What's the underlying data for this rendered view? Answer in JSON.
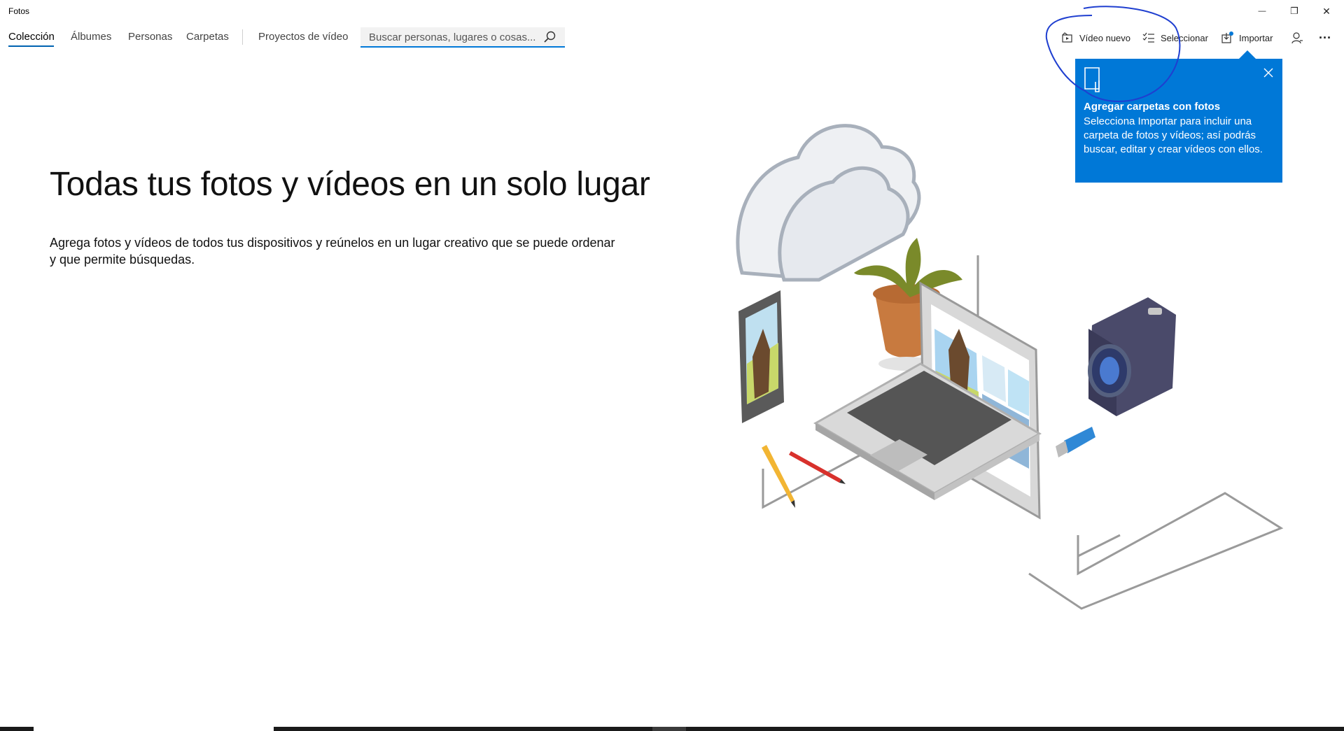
{
  "app": {
    "title": "Fotos"
  },
  "window_controls": {
    "minimize": "—",
    "restore": "❐",
    "close": "✕"
  },
  "nav": {
    "items": [
      {
        "label": "Colección",
        "active": true
      },
      {
        "label": "Álbumes"
      },
      {
        "label": "Personas"
      },
      {
        "label": "Carpetas"
      },
      {
        "label": "Proyectos de vídeo"
      }
    ]
  },
  "search": {
    "placeholder": "Buscar personas, lugares o cosas..."
  },
  "toolbar": {
    "new_video": "Vídeo nuevo",
    "select": "Seleccionar",
    "import": "Importar",
    "more": "···"
  },
  "hero": {
    "title": "Todas tus fotos y vídeos en un solo lugar",
    "description": "Agrega fotos y vídeos de todos tus dispositivos y reúnelos en un lugar creativo que se puede ordenar y que permite búsquedas."
  },
  "tip": {
    "title": "Agregar carpetas con fotos",
    "body": "Selecciona Importar para incluir una carpeta de fotos y vídeos; así podrás buscar, editar y crear vídeos con ellos."
  },
  "colors": {
    "accent": "#0078d7",
    "annotation": "#1f3fd0"
  }
}
